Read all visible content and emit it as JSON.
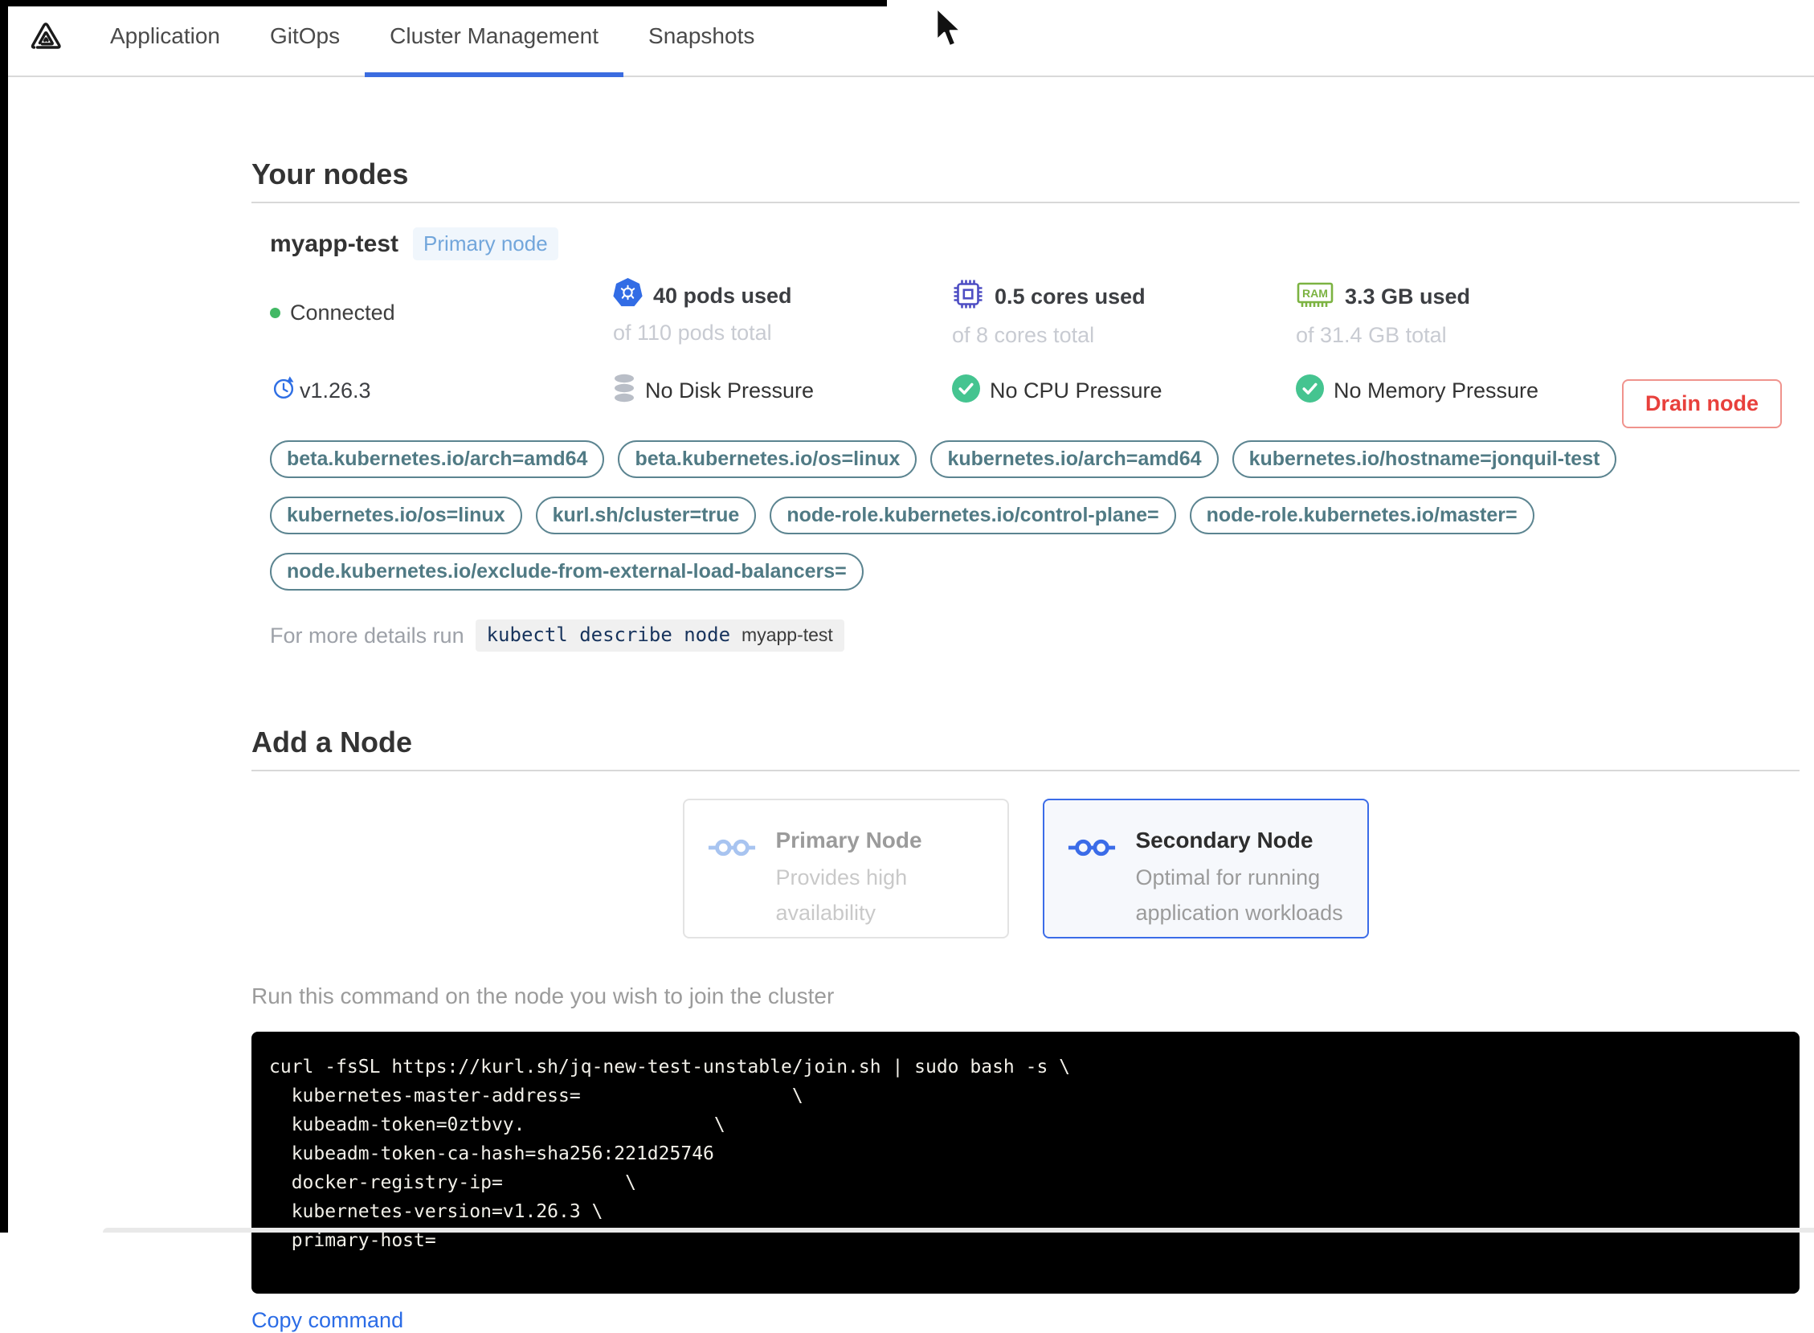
{
  "nav": {
    "logo": "replicated-logo",
    "tabs": [
      {
        "label": "Application",
        "active": false
      },
      {
        "label": "GitOps",
        "active": false
      },
      {
        "label": "Cluster Management",
        "active": true
      },
      {
        "label": "Snapshots",
        "active": false
      }
    ]
  },
  "your_nodes": {
    "title": "Your nodes",
    "node": {
      "name": "myapp-test",
      "badge": "Primary node",
      "status": "Connected",
      "stats": [
        {
          "icon": "kubernetes-icon",
          "value": "40 pods used",
          "sub": "of 110 pods total"
        },
        {
          "icon": "cpu-icon",
          "value": "0.5 cores used",
          "sub": "of 8 cores total"
        },
        {
          "icon": "ram-icon",
          "value": "3.3 GB used",
          "sub": "of 31.4 GB total"
        }
      ],
      "conditions": [
        {
          "icon": "version-icon",
          "label": "v1.26.3"
        },
        {
          "icon": "disk-icon",
          "label": "No Disk Pressure"
        },
        {
          "icon": "check-icon",
          "label": "No CPU Pressure"
        },
        {
          "icon": "check-icon",
          "label": "No Memory Pressure"
        }
      ],
      "labels": [
        "beta.kubernetes.io/arch=amd64",
        "beta.kubernetes.io/os=linux",
        "kubernetes.io/arch=amd64",
        "kubernetes.io/hostname=jonquil-test",
        "kubernetes.io/os=linux",
        "kurl.sh/cluster=true",
        "node-role.kubernetes.io/control-plane=",
        "node-role.kubernetes.io/master=",
        "node.kubernetes.io/exclude-from-external-load-balancers="
      ],
      "details_prefix": "For more details run",
      "details_command": "kubectl describe node",
      "details_node": "myapp-test",
      "drain_button": "Drain node"
    }
  },
  "add_node": {
    "title": "Add a Node",
    "options": [
      {
        "title": "Primary Node",
        "description": "Provides high availability",
        "selected": false
      },
      {
        "title": "Secondary Node",
        "description": "Optimal for running application workloads",
        "selected": true
      }
    ],
    "instruction": "Run this command on the node you wish to join the cluster",
    "command_lines": [
      "curl -fsSL https://kurl.sh/jq-new-test-unstable/join.sh | sudo bash -s \\",
      "  kubernetes-master-address=                   \\",
      "  kubeadm-token=0ztbvy.                 \\",
      "  kubeadm-token-ca-hash=sha256:221d25746",
      "  docker-registry-ip=           \\",
      "  kubernetes-version=v1.26.3 \\",
      "  primary-host="
    ],
    "copy_label": "Copy command"
  },
  "colors": {
    "accent_blue": "#3b6ce8",
    "kubernetes_blue": "#326ce5",
    "cpu_indigo": "#4d4dc3",
    "ram_green": "#7cb342",
    "success_green": "#45c490",
    "connected_green": "#41b864",
    "danger_red": "#e8403c",
    "label_teal": "#507a84",
    "terminal_bg": "#000000"
  }
}
